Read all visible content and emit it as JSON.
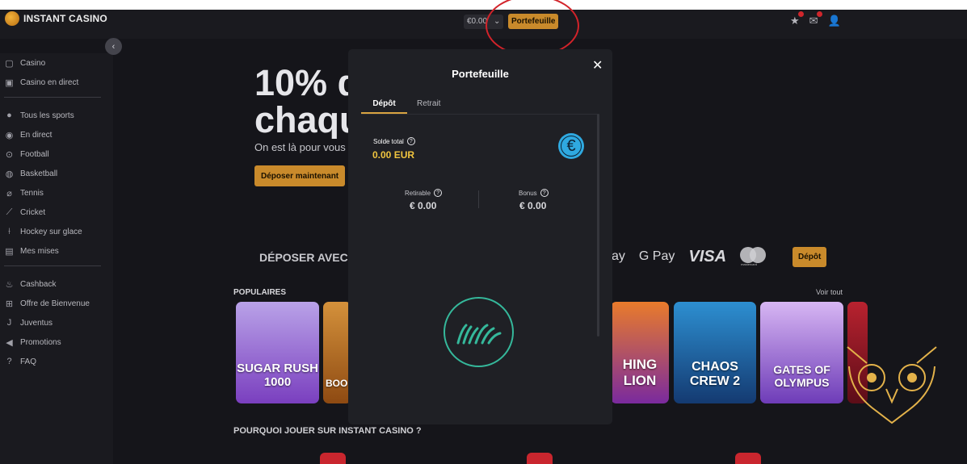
{
  "header": {
    "brand": "INSTANT CASINO",
    "balance": "€0.00",
    "wallet_button": "Portefeuille",
    "highlight_color": "#d2232a"
  },
  "sidebar": {
    "collapse_icon": "chevron-left-icon",
    "group1": [
      {
        "label": "Casino",
        "icon": "casino-icon"
      },
      {
        "label": "Casino en direct",
        "icon": "live-casino-icon"
      }
    ],
    "group2": [
      {
        "label": "Tous les sports",
        "icon": "sports-icon"
      },
      {
        "label": "En direct",
        "icon": "broadcast-icon"
      },
      {
        "label": "Football",
        "icon": "football-icon"
      },
      {
        "label": "Basketball",
        "icon": "basketball-icon"
      },
      {
        "label": "Tennis",
        "icon": "tennis-icon"
      },
      {
        "label": "Cricket",
        "icon": "cricket-icon"
      },
      {
        "label": "Hockey sur glace",
        "icon": "hockey-icon"
      },
      {
        "label": "Mes mises",
        "icon": "bets-icon"
      }
    ],
    "group3": [
      {
        "label": "Cashback",
        "icon": "flame-icon"
      },
      {
        "label": "Offre de Bienvenue",
        "icon": "gift-icon"
      },
      {
        "label": "Juventus",
        "icon": "juventus-icon"
      },
      {
        "label": "Promotions",
        "icon": "megaphone-icon"
      },
      {
        "label": "FAQ",
        "icon": "faq-icon"
      }
    ]
  },
  "hero": {
    "title": "10% d\nchaqu",
    "subtitle": "On est là pour vous",
    "cta": "Déposer maintenant"
  },
  "payments": {
    "heading": "DÉPOSER AVEC",
    "logos": [
      "ay",
      "G Pay",
      "VISA",
      "mastercard"
    ],
    "deposit_button": "Dépôt"
  },
  "games": {
    "heading": "POPULAIRES",
    "see_all": "Voir tout",
    "tiles": [
      "SUGAR RUSH 1000",
      "BOO",
      "HING LION",
      "CHAOS CREW 2",
      "GATES OF OLYMPUS",
      ""
    ]
  },
  "why": {
    "heading": "POURQUOI JOUER SUR INSTANT CASINO ?"
  },
  "wallet_modal": {
    "title": "Portefeuille",
    "close_icon": "close-icon",
    "tabs": [
      "Dépôt",
      "Retrait"
    ],
    "active_tab": "Dépôt",
    "total_label": "Solde total",
    "total_value": "0.00 EUR",
    "currency_icon": "euro-coin-icon",
    "withdrawable_label": "Retirable",
    "withdrawable_value": "€ 0.00",
    "bonus_label": "Bonus",
    "bonus_value": "€ 0.00",
    "loader_icon": "loading-spinner-icon"
  },
  "colors": {
    "accent": "#c98a2b",
    "gold_text": "#f0c53f",
    "euro": "#2fa9e0",
    "spinner": "#35b89b"
  }
}
